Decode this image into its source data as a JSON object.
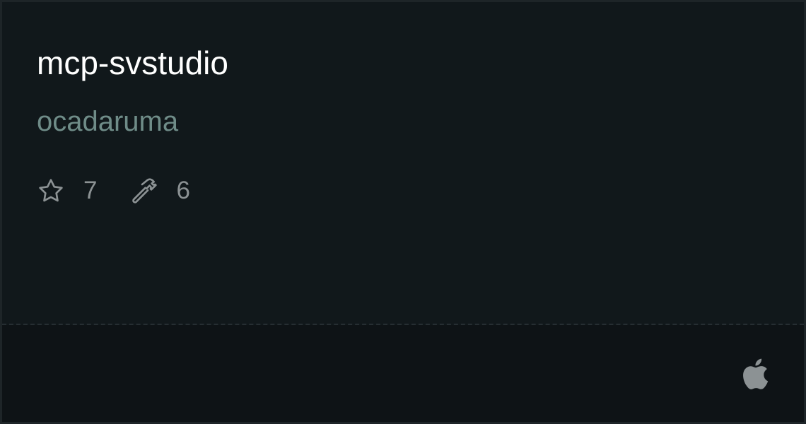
{
  "card": {
    "title": "mcp-svstudio",
    "owner": "ocadaruma",
    "stats": {
      "stars": {
        "icon": "star-icon",
        "value": "7"
      },
      "tools": {
        "icon": "hammer-icon",
        "value": "6"
      }
    },
    "platform_icon": "apple-icon"
  },
  "colors": {
    "background": "#11181b",
    "footer_background": "#0e1316",
    "title": "#ffffff",
    "owner": "#6f8c88",
    "stat_text": "#8c9294"
  }
}
